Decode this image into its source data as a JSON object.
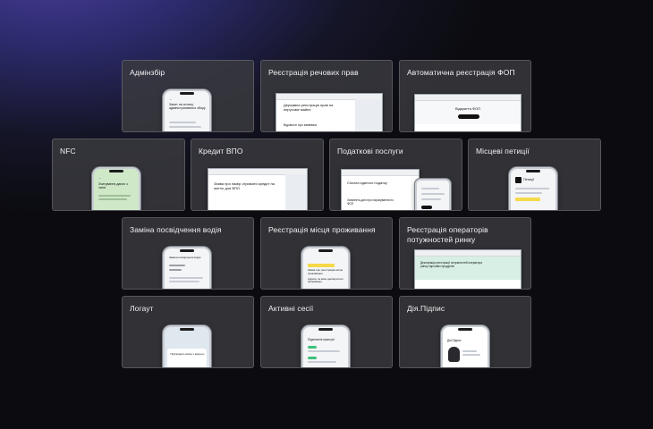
{
  "cards": [
    {
      "title": "Адмінзбір",
      "preview_text": "Запит на сплату адміністративного збору"
    },
    {
      "title": "Реєстрація речових прав",
      "preview_text": "Державна реєстрація прав на нерухоме майно",
      "preview_subtext": "Відомості про заявника"
    },
    {
      "title": "Автоматична реєстрація ФОП",
      "preview_text": "Відкриття ФОП"
    },
    {
      "title": "NFC",
      "preview_text": "Зчитування даних з чипа"
    },
    {
      "title": "Кредит ВПО",
      "preview_text": "Заява про намір отримати кредит на житло для ВПО"
    },
    {
      "title": "Податкові послуги",
      "preview_text": "Сплата єдиного податку",
      "preview_subtext": "Заповніть дані про нарахування по ФОП"
    },
    {
      "title": "Місцеві петиції",
      "preview_text": "Петиції"
    },
    {
      "title": "Заміна посвідчення водія",
      "preview_text": "Заміна посвідчення водія"
    },
    {
      "title": "Реєстрація місця проживання",
      "preview_text": "Заява про реєстрацію місця проживання",
      "preview_subtext": "Адреса, за якою декларується проживання"
    },
    {
      "title": "Реєстрація операторів потужностей ринку",
      "preview_text": "Декларація реєстрації потужностей оператора ринку харчових продуктів"
    },
    {
      "title": "Логаут",
      "preview_text": "Підтвердіть вихід з акаунту"
    },
    {
      "title": "Активні сесії",
      "preview_text": "Підключені пристрої"
    },
    {
      "title": "Дія.Підпис",
      "preview_text": "Дія.Підпис"
    }
  ]
}
